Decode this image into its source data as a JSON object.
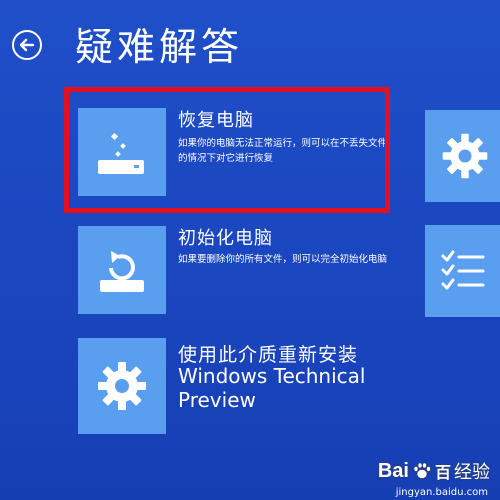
{
  "header": {
    "title": "疑难解答",
    "back_icon": "back-arrow-icon"
  },
  "options": [
    {
      "title": "恢复电脑",
      "description": "如果你的电脑无法正常运行，则可以在不丢失文件的情况下对它进行恢复",
      "icon": "refresh-pc-icon",
      "highlighted": true
    },
    {
      "title": "初始化电脑",
      "description": "如果要删除你的所有文件，则可以完全初始化电脑",
      "icon": "reset-pc-icon"
    },
    {
      "title": "使用此介质重新安装",
      "subtitle_line1": "Windows Technical",
      "subtitle_line2": "Preview",
      "icon": "gear-icon"
    }
  ],
  "side_tiles": [
    {
      "icon": "gear-icon"
    },
    {
      "icon": "checklist-icon"
    }
  ],
  "watermark": {
    "brand_part1": "Bai",
    "brand_part2": "百",
    "label": "经验",
    "url": "jingyan.baidu.com"
  },
  "colors": {
    "background": "#1a46bf",
    "tile": "#5a9ef0",
    "highlight": "#e4101c"
  }
}
